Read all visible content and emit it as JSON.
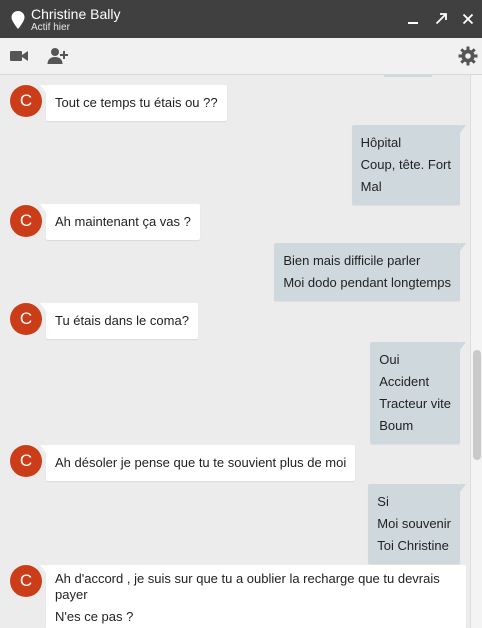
{
  "window": {
    "contact_name": "Christine Bally",
    "contact_status": "Actif hier"
  },
  "avatar_letter": "C",
  "messages": [
    {
      "dir": "in",
      "lines": [
        "Tout ce temps tu étais ou ??"
      ]
    },
    {
      "dir": "out",
      "lines": [
        "Hôpital",
        "Coup, tête. Fort",
        "Mal"
      ]
    },
    {
      "dir": "in",
      "lines": [
        "Ah maintenant ça vas ?"
      ]
    },
    {
      "dir": "out",
      "lines": [
        "Bien mais difficile parler",
        "Moi dodo pendant longtemps"
      ]
    },
    {
      "dir": "in",
      "lines": [
        "Tu étais dans le coma?"
      ]
    },
    {
      "dir": "out",
      "lines": [
        "Oui",
        "Accident",
        "Tracteur vite",
        "Boum"
      ]
    },
    {
      "dir": "in",
      "lines": [
        "Ah désoler je pense que tu te souvient plus de moi"
      ]
    },
    {
      "dir": "out",
      "lines": [
        "Si",
        "Moi souvenir",
        "Toi Christine"
      ]
    },
    {
      "dir": "in",
      "lines": [
        "Ah d'accord  , je suis sur que tu a oublier la recharge que tu devrais payer",
        "N'es ce pas ?"
      ]
    }
  ],
  "colors": {
    "titlebar_bg": "#404040",
    "avatar_bg": "#cb3d18",
    "incoming_bubble": "#ffffff",
    "outgoing_bubble": "#cfd8dc",
    "chat_bg": "#ececec"
  },
  "icons": {
    "contact": "location-pin-icon",
    "minimize": "minimize-icon",
    "popout": "popout-arrow-icon",
    "close": "close-icon",
    "video": "video-camera-icon",
    "add_person": "add-person-icon",
    "settings": "gear-icon"
  }
}
